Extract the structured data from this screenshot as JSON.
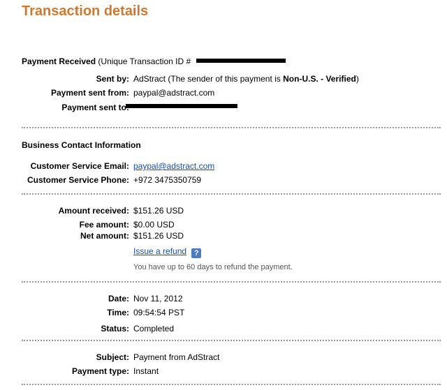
{
  "title": "Transaction details",
  "payment_received": {
    "heading": "Payment Received",
    "txn_prefix": "(Unique Transaction ID #"
  },
  "sender": {
    "sent_by_label": "Sent by:",
    "sent_by_name": "AdStract",
    "sent_by_note_prefix": "(The sender of this payment is",
    "sent_by_status": "Non-U.S. - Verified",
    "sent_by_note_suffix": ")",
    "sent_from_label": "Payment sent from:",
    "sent_from_value": "paypal@adstract.com",
    "sent_to_label": "Payment sent to:"
  },
  "business": {
    "heading": "Business Contact Information",
    "email_label": "Customer Service Email:",
    "email_value": "paypal@adstract.com",
    "phone_label": "Customer Service Phone:",
    "phone_value": "+972 3475350759"
  },
  "amounts": {
    "received_label": "Amount received:",
    "received_value": "$151.26 USD",
    "fee_label": "Fee amount:",
    "fee_value": "$0.00 USD",
    "net_label": "Net amount:",
    "net_value": "$151.26 USD",
    "refund_link": "Issue a refund",
    "help_icon": "?",
    "refund_note": "You have up to 60 days to refund the payment."
  },
  "status_info": {
    "date_label": "Date:",
    "date_value": "Nov 11, 2012",
    "time_label": "Time:",
    "time_value": "09:54:54 PST",
    "status_label": "Status:",
    "status_value": "Completed"
  },
  "details": {
    "subject_label": "Subject:",
    "subject_value": "Payment from AdStract",
    "type_label": "Payment type:",
    "type_value": "Instant"
  },
  "colors": {
    "title": "#cc7a33",
    "link": "#1a4fa3",
    "help_icon_bg": "#4a7cc0"
  }
}
